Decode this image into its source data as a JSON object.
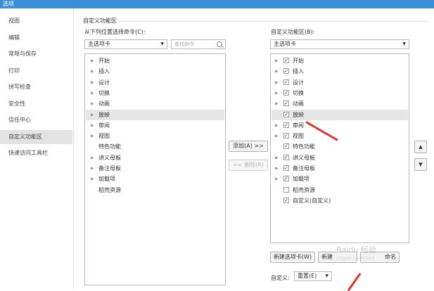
{
  "window": {
    "title": "选项"
  },
  "sidebar": {
    "items": [
      {
        "label": "视图"
      },
      {
        "label": "编辑"
      },
      {
        "label": "常规与保存"
      },
      {
        "label": "打印"
      },
      {
        "label": "拼写检查"
      },
      {
        "label": "安全性"
      },
      {
        "label": "信任中心"
      },
      {
        "label": "自定义功能区"
      },
      {
        "label": "快速访问工具栏"
      }
    ],
    "active_index": 7
  },
  "section": {
    "title": "自定义功能区"
  },
  "left_panel": {
    "label": "从下列位置选择命令(C):",
    "dropdown_value": "主选项卡",
    "search_placeholder": "查找命令",
    "items": [
      {
        "label": "开始",
        "expandable": true
      },
      {
        "label": "插入",
        "expandable": true
      },
      {
        "label": "设计",
        "expandable": true
      },
      {
        "label": "切换",
        "expandable": true
      },
      {
        "label": "动画",
        "expandable": true
      },
      {
        "label": "放映",
        "expandable": true
      },
      {
        "label": "审阅",
        "expandable": true
      },
      {
        "label": "视图",
        "expandable": true
      },
      {
        "label": "特色功能",
        "expandable": false
      },
      {
        "label": "讲义母板",
        "expandable": true
      },
      {
        "label": "备注母板",
        "expandable": true
      },
      {
        "label": "加载项",
        "expandable": true
      },
      {
        "label": "稻壳资源",
        "expandable": false
      }
    ],
    "selected_index": 5
  },
  "middle": {
    "add_label": "添加(A) >>",
    "remove_label": "<< 删除(R)"
  },
  "right_panel": {
    "label": "自定义功能区(B):",
    "dropdown_value": "主选项卡",
    "items": [
      {
        "label": "开始",
        "checked": true,
        "expandable": true
      },
      {
        "label": "插入",
        "checked": true,
        "expandable": true
      },
      {
        "label": "设计",
        "checked": true,
        "expandable": true
      },
      {
        "label": "切换",
        "checked": true,
        "expandable": true
      },
      {
        "label": "动画",
        "checked": true,
        "expandable": true
      },
      {
        "label": "放映",
        "checked": true,
        "expandable": false
      },
      {
        "label": "审阅",
        "checked": true,
        "expandable": true
      },
      {
        "label": "视图",
        "checked": true,
        "expandable": true
      },
      {
        "label": "特色功能",
        "checked": true,
        "expandable": false
      },
      {
        "label": "讲义母板",
        "checked": true,
        "expandable": true
      },
      {
        "label": "备注母板",
        "checked": true,
        "expandable": true
      },
      {
        "label": "加载项",
        "checked": true,
        "expandable": true
      },
      {
        "label": "稻壳资源",
        "checked": false,
        "expandable": false
      },
      {
        "label": "自定义(自定义)",
        "checked": true,
        "expandable": false
      }
    ],
    "selected_index": 5,
    "new_tab_label": "新建选项卡(W)",
    "new_group_label": "新建",
    "rename_label": "命名",
    "customize_label": "自定义:",
    "reset_label": "重置(E)"
  },
  "icons": {
    "move_up": "triangle-up-icon",
    "move_down": "triangle-down-icon",
    "expand": "triangle-right-icon",
    "check": "check-icon",
    "dropdown": "triangle-down-icon"
  },
  "annotation_color": "#e5322d",
  "watermark": {
    "main": "Baidu 经验",
    "sub": "jingyan.baidu.com"
  }
}
